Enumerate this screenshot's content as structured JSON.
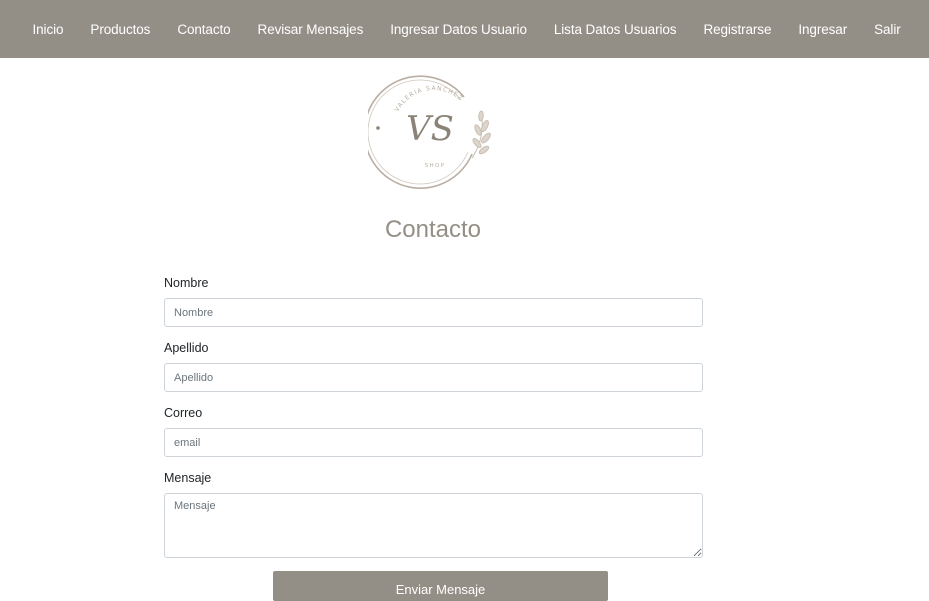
{
  "nav": {
    "items": [
      {
        "label": "Inicio"
      },
      {
        "label": "Productos"
      },
      {
        "label": "Contacto"
      },
      {
        "label": "Revisar Mensajes"
      },
      {
        "label": "Ingresar Datos Usuario"
      },
      {
        "label": "Lista Datos Usuarios"
      },
      {
        "label": "Registrarse"
      },
      {
        "label": "Ingresar"
      },
      {
        "label": "Salir"
      }
    ]
  },
  "logo": {
    "brand_arc_text": "VALERIA SANCHEZ",
    "monogram": "VS",
    "subtext": "SHOP"
  },
  "page": {
    "title": "Contacto"
  },
  "form": {
    "nombre": {
      "label": "Nombre",
      "placeholder": "Nombre",
      "value": ""
    },
    "apellido": {
      "label": "Apellido",
      "placeholder": "Apellido",
      "value": ""
    },
    "correo": {
      "label": "Correo",
      "placeholder": "email",
      "value": ""
    },
    "mensaje": {
      "label": "Mensaje",
      "placeholder": "Mensaje",
      "value": ""
    },
    "submit_label": "Enviar Mensaje"
  },
  "colors": {
    "navbar": "#948f86",
    "accent": "#948f86",
    "logo": "#b8aea3"
  }
}
